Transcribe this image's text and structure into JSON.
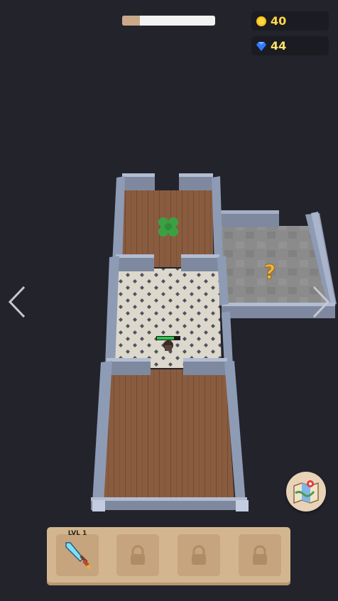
{
  "hud": {
    "progress_fraction": 0.19,
    "coins": "40",
    "gems": "44"
  },
  "colors": {
    "background": "#23232c",
    "wood_floor": "#8a5c3f",
    "tile_floor": "#ddd8cc",
    "stone_floor": "#8e8e8e",
    "wall": "#8e9bb5",
    "coin": "#ffd84a",
    "gem": "#2f7bff",
    "health_bar": "#2ec44a"
  },
  "icons": {
    "coin": "coin-icon",
    "gem": "gem-icon",
    "clover": "clover-icon",
    "mystery": "question-mark-icon",
    "map": "map-icon",
    "sword": "sword-icon",
    "lock": "lock-icon"
  },
  "inventory": {
    "slots": [
      {
        "label": "LVL 1",
        "item": "sword",
        "locked": false
      },
      {
        "label": "",
        "item": "lock",
        "locked": true
      },
      {
        "label": "",
        "item": "lock",
        "locked": true
      },
      {
        "label": "",
        "item": "lock",
        "locked": true
      }
    ]
  },
  "mystery_mark": "?"
}
